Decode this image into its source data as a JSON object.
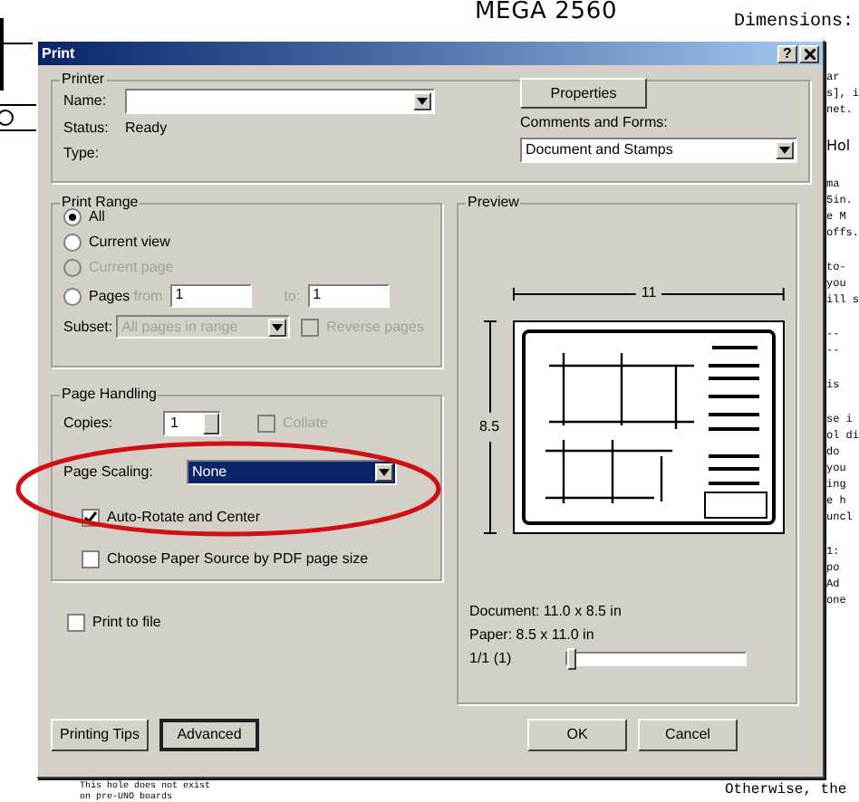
{
  "background_document": {
    "heading": "MEGA 2560",
    "dimensions_label": "Dimensions:",
    "right_groups": [
      [
        "ar",
        "s], i",
        "net."
      ],
      [
        "Hol"
      ],
      [
        "ma",
        "5in.",
        "e M",
        "offs."
      ],
      [
        "to-",
        "you",
        "ill s"
      ],
      [
        "--",
        "--"
      ],
      [
        "is"
      ],
      [
        "se i",
        "ol di",
        "do",
        "you",
        "ing",
        "e h",
        "uncl"
      ],
      [
        "1:",
        "po",
        "Ad",
        "one"
      ]
    ],
    "note_lines": [
      "This hole does not exist",
      "on pre-UNO boards"
    ],
    "footer_fragment": "Otherwise, the"
  },
  "window": {
    "title": "Print",
    "help_button": "?"
  },
  "printer": {
    "title": "Printer",
    "name_label": "Name:",
    "status_label": "Status:",
    "status": "Ready",
    "type_label": "Type:",
    "properties_button": "Properties",
    "comments_label": "Comments and Forms:",
    "comments_value": "Document and Stamps"
  },
  "print_range": {
    "title": "Print Range",
    "options": [
      {
        "label": "All",
        "selected": true,
        "disabled": false
      },
      {
        "label": "Current view",
        "selected": false,
        "disabled": false
      },
      {
        "label": "Current page",
        "selected": false,
        "disabled": true
      },
      {
        "label": "Pages",
        "selected": false,
        "disabled": false
      }
    ],
    "from_label": "from",
    "from_value": "1",
    "to_label": "to:",
    "to_value": "1",
    "subset_label": "Subset:",
    "subset_value": "All pages in range",
    "reverse_pages": {
      "label": "Reverse pages",
      "checked": false,
      "disabled": true
    }
  },
  "page_handling": {
    "title": "Page Handling",
    "copies_label": "Copies:",
    "copies_value": "1",
    "collate": {
      "label": "Collate",
      "checked": false,
      "disabled": true
    },
    "scaling_label": "Page Scaling:",
    "scaling_value": "None",
    "auto_rotate": {
      "label": "Auto-Rotate and Center",
      "checked": true,
      "disabled": false
    },
    "paper_source": {
      "label": "Choose Paper Source by PDF page size",
      "checked": false,
      "disabled": false
    }
  },
  "print_to_file": {
    "label": "Print to file",
    "checked": false,
    "disabled": false
  },
  "preview": {
    "title": "Preview",
    "width_label": "11",
    "height_label": "8.5",
    "document_size": "Document: 11.0 x 8.5 in",
    "paper_size": "Paper: 8.5 x 11.0 in",
    "page_count": "1/1 (1)",
    "slider": {
      "level": 0
    }
  },
  "buttons_left": [
    {
      "label": "Printing Tips",
      "focused": false
    },
    {
      "label": "Advanced",
      "focused": true
    }
  ],
  "buttons_right": [
    {
      "label": "OK",
      "focused": false
    },
    {
      "label": "Cancel",
      "focused": false
    }
  ]
}
